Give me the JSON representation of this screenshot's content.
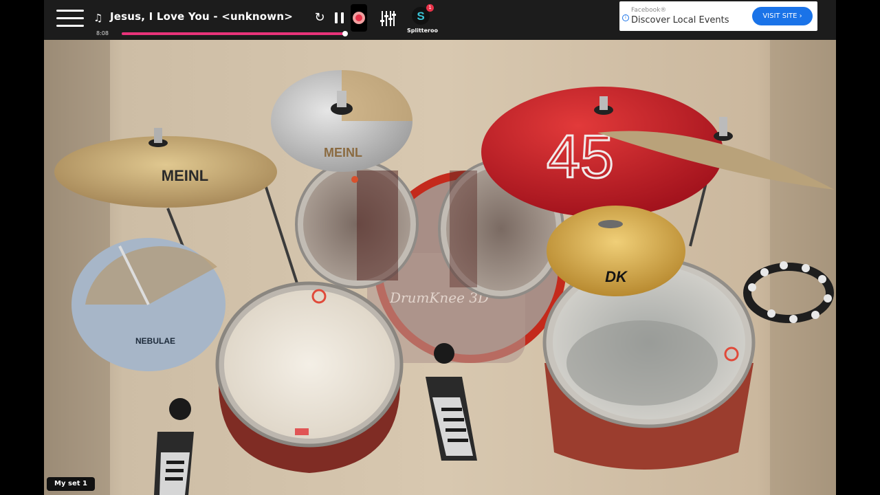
{
  "player": {
    "song_title": "Jesus, I Love You - <unknown>",
    "elapsed": "8:08",
    "progress_fraction": 0.99
  },
  "splitter": {
    "label": "Splitteroo",
    "badge_count": "1"
  },
  "ad": {
    "source": "Facebook®",
    "text": "Discover Local Events",
    "button_label": "VISIT SITE"
  },
  "kit": {
    "brand_text": "DrumKnee 3D",
    "cymbal_logo_meinl": "MEINL",
    "cymbal_logo_red": "45",
    "cymbal_logo_dk": "DK",
    "cymbal_logo_nebulae": "NEBULAE"
  },
  "set_label": "My set 1",
  "colors": {
    "accent_pink": "#e8337a",
    "record_red": "#e8334a",
    "ad_blue": "#1a73e8"
  }
}
